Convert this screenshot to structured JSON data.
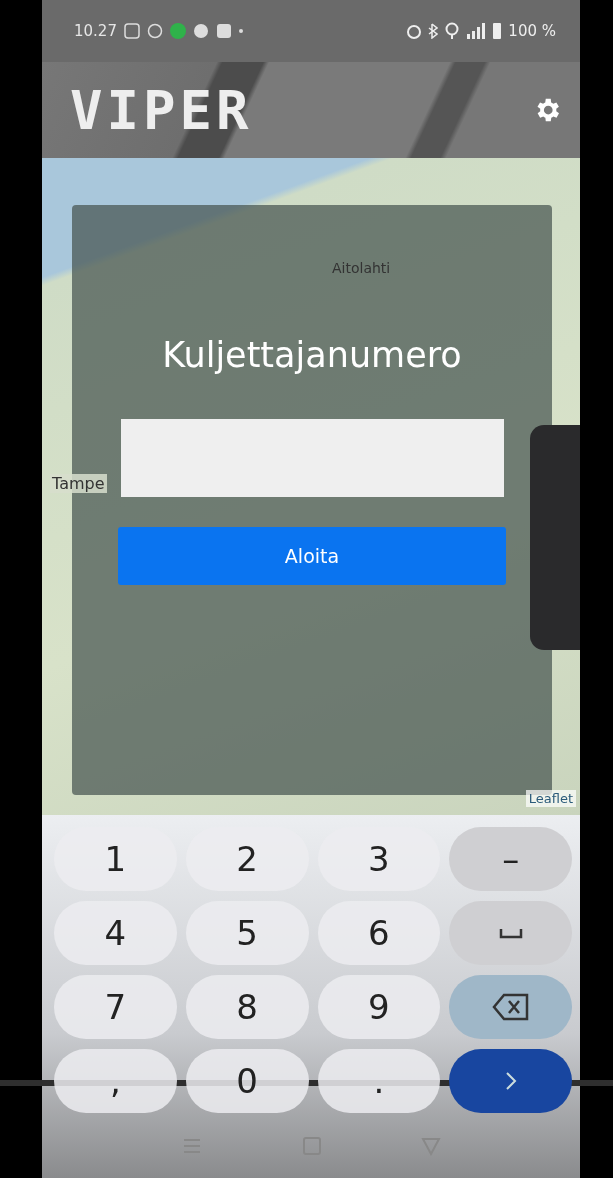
{
  "status_bar": {
    "time": "10.27",
    "battery": "100 %"
  },
  "header": {
    "logo": "VIPER"
  },
  "map": {
    "labels": [
      {
        "text": "Aitolahti"
      },
      {
        "text": "Tampe"
      }
    ],
    "attribution": "Leaflet"
  },
  "login": {
    "title": "Kuljettajanumero",
    "button": "Aloita"
  },
  "keyboard": {
    "keys": [
      {
        "kind": "char",
        "label": "1"
      },
      {
        "kind": "char",
        "label": "2"
      },
      {
        "kind": "char",
        "label": "3"
      },
      {
        "kind": "func",
        "label": "–"
      },
      {
        "kind": "char",
        "label": "4"
      },
      {
        "kind": "char",
        "label": "5"
      },
      {
        "kind": "char",
        "label": "6"
      },
      {
        "kind": "space"
      },
      {
        "kind": "char",
        "label": "7"
      },
      {
        "kind": "char",
        "label": "8"
      },
      {
        "kind": "char",
        "label": "9"
      },
      {
        "kind": "backspace"
      },
      {
        "kind": "char",
        "label": ","
      },
      {
        "kind": "char",
        "label": "0"
      },
      {
        "kind": "char",
        "label": "."
      },
      {
        "kind": "enter"
      }
    ]
  }
}
